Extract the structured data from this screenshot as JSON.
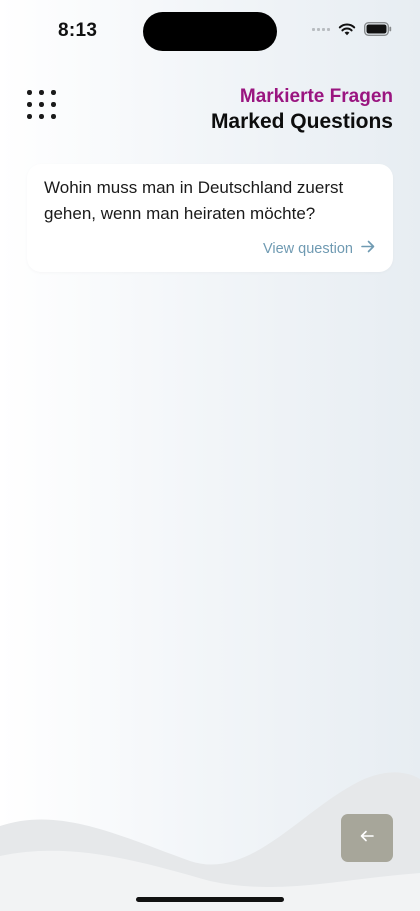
{
  "status_bar": {
    "time": "8:13",
    "wifi_icon": "wifi-icon",
    "battery_icon": "battery-icon"
  },
  "header": {
    "menu_icon": "grid-dots-icon",
    "title_de": "Markierte Fragen",
    "title_en": "Marked Questions"
  },
  "questions": [
    {
      "text": "Wohin muss man in Deutschland zuerst gehen, wenn man heiraten möchte?",
      "link_label": "View question",
      "link_icon": "arrow-right-icon"
    }
  ],
  "footer": {
    "back_icon": "arrow-left-icon"
  },
  "colors": {
    "accent_magenta": "#9a1580",
    "link_blue": "#6f9ab2",
    "back_button": "#a7a69a"
  }
}
